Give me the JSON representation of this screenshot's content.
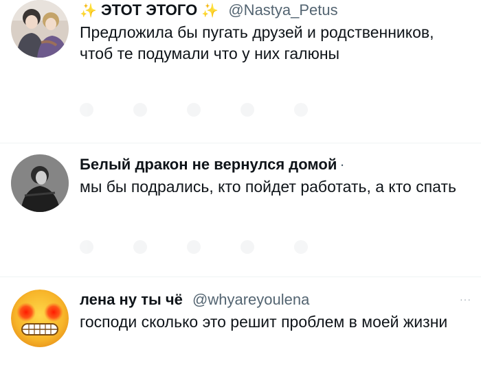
{
  "tweets": [
    {
      "name": "ЭТОТ ЭТОГО",
      "sparkle_left": "✨",
      "sparkle_right": "✨",
      "handle": "@Nastya_Petus",
      "text": "Предложила бы пугать друзей и родственников, чтоб те подумали что у них галюны",
      "avatar_icon": "two-people-illustration"
    },
    {
      "name": "Белый дракон не вернулся домой",
      "separator": "·",
      "text": "мы бы подрались, кто пойдет работать, а кто спать",
      "avatar_icon": "dark-figure-illustration"
    },
    {
      "name": "лена ну ты чё",
      "handle": "@whyareyoulena",
      "text": "господи сколько это решит проблем в моей жизни",
      "avatar_icon": "grimacing-face-emoji",
      "menu": "···"
    }
  ],
  "colors": {
    "text_primary": "#0f1419",
    "text_secondary": "#536471",
    "divider": "#eff3f4",
    "sparkle": "#f5c518"
  }
}
